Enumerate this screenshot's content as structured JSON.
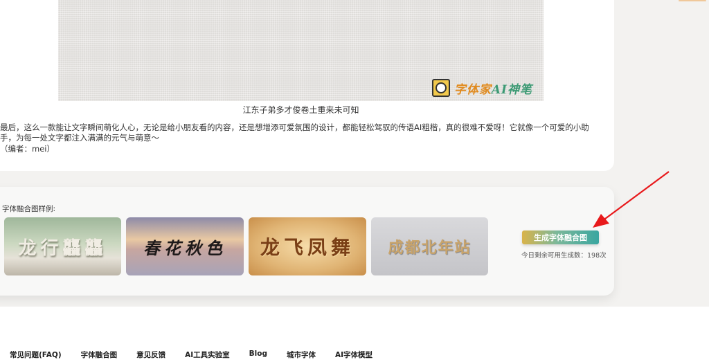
{
  "article": {
    "watermark_brand": "字体家",
    "watermark_ai": "AI",
    "watermark_pen": "神笔",
    "caption": "江东子弟多才俊卷土重来未可知",
    "paragraph_line1": "最后，这么一款能让文字瞬间萌化人心，无论是给小朋友看的内容，还是想增添可爱氛围的设计，都能轻松驾驭的传语AI粗楷，真的很难不爱呀！它就像一个可爱的小助",
    "paragraph_line2": "手，为每一处文字都注入满满的元气与萌意～",
    "editor": "（编者：mei）"
  },
  "samples": {
    "label": "字体融合图样例:",
    "items": [
      {
        "text": "龙行龘龘"
      },
      {
        "text": "春花秋色"
      },
      {
        "text": "龙飞凤舞"
      },
      {
        "text": "成都北年站"
      }
    ],
    "generate_button": "生成字体融合图",
    "remaining": "今日剩余可用生成数：198次"
  },
  "footer": {
    "links": [
      "常见问题(FAQ)",
      "字体融合图",
      "意见反馈",
      "AI工具实验室",
      "Blog",
      "城市字体",
      "AI字体模型"
    ]
  },
  "colors": {
    "annotation_arrow": "#e8191b",
    "button_gradient_start": "#d9b34a",
    "button_gradient_end": "#3aa6a0"
  }
}
